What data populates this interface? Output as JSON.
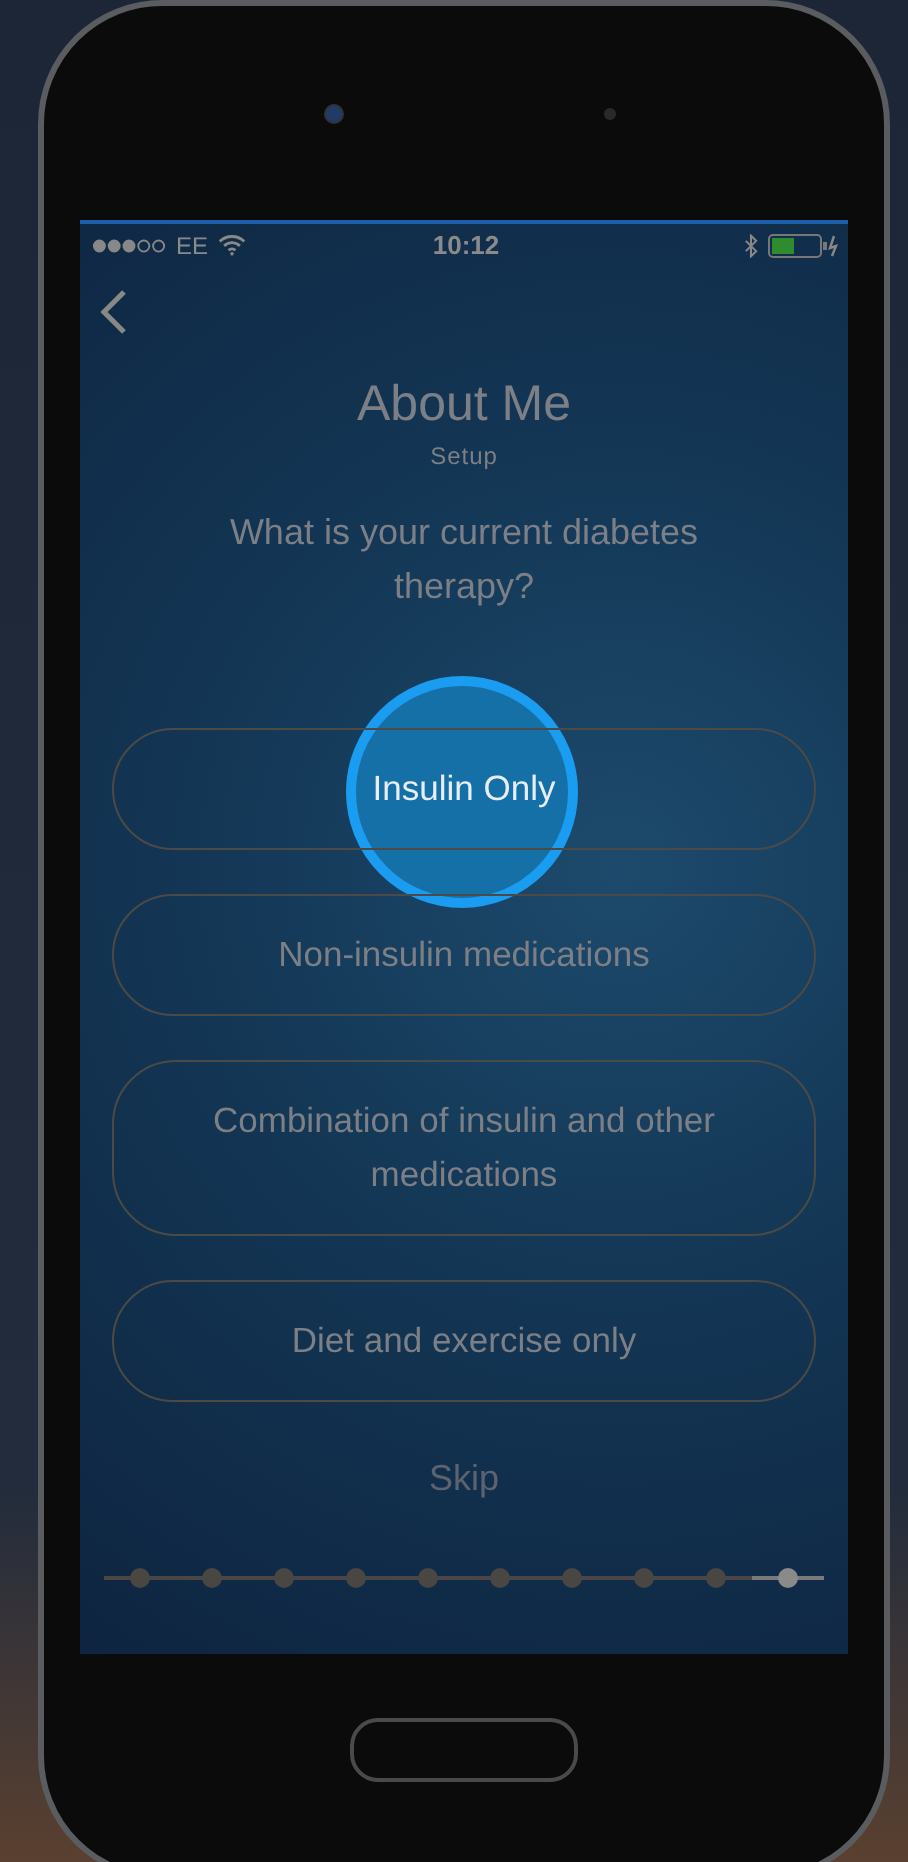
{
  "status_bar": {
    "carrier": "EE",
    "time": "10:12"
  },
  "header": {
    "title": "About Me",
    "subtitle": "Setup"
  },
  "question": "What is your current diabetes therapy?",
  "options": [
    {
      "label": "Insulin Only",
      "selected": true
    },
    {
      "label": "Non-insulin medications",
      "selected": false
    },
    {
      "label": "Combination of insulin and other medications",
      "selected": false
    },
    {
      "label": "Diet and exercise only",
      "selected": false
    }
  ],
  "skip": "Skip",
  "progress": [
    {
      "selected": false
    },
    {
      "selected": false
    },
    {
      "selected": false
    },
    {
      "selected": false
    },
    {
      "selected": false
    },
    {
      "selected": false
    },
    {
      "selected": false
    },
    {
      "selected": false
    },
    {
      "selected": false
    },
    {
      "selected": true
    }
  ]
}
